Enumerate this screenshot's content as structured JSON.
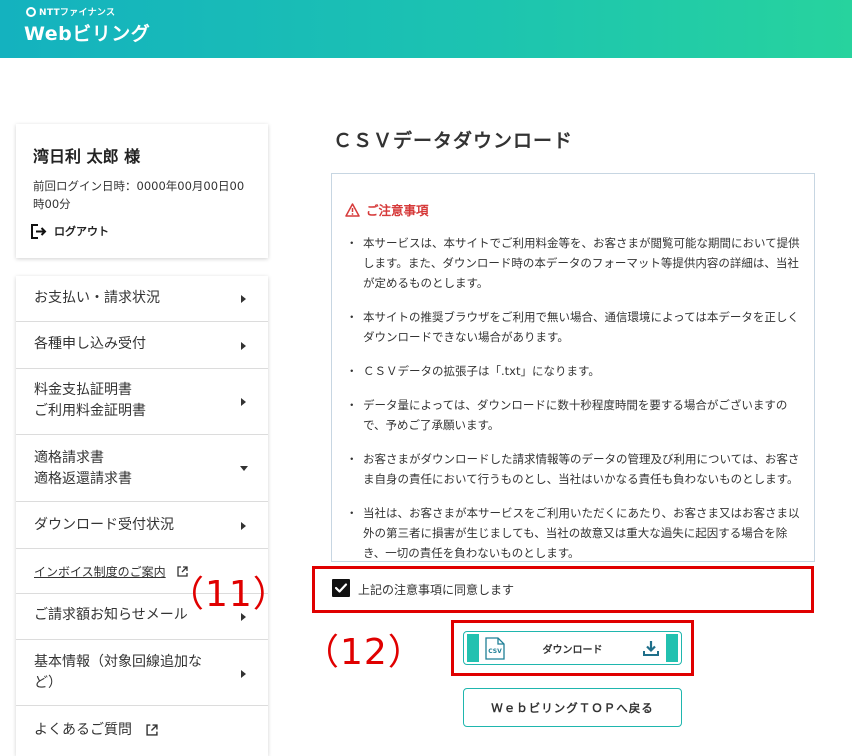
{
  "header": {
    "brand_small": "NTTファイナンス",
    "app_name": "Webビリング"
  },
  "user": {
    "name": "湾日利 太郎 様",
    "last_login": "前回ログイン日時：0000年00月00日00時00分",
    "logout_label": "ログアウト"
  },
  "nav": {
    "items": [
      {
        "label": "お支払い・請求状況"
      },
      {
        "label": "各種申し込み受付"
      },
      {
        "label_line1": "料金支払証明書",
        "label_line2": "ご利用料金証明書"
      },
      {
        "label_line1": "適格請求書",
        "label_line2": "適格返還請求書"
      },
      {
        "label": "ダウンロード受付状況"
      },
      {
        "label": "インボイス制度のご案内"
      },
      {
        "label": "ご請求額お知らせメール"
      },
      {
        "label_line1": "基本情報（対象回線追加な",
        "label_line2": "ど）"
      },
      {
        "label": "よくあるご質問"
      }
    ]
  },
  "main": {
    "title": "ＣＳＶデータダウンロード",
    "notice_title": "ご注意事項",
    "notice_bullet": "・",
    "notice_items": [
      "本サービスは、本サイトでご利用料金等を、お客さまが閲覧可能な期間において提供します。また、ダウンロード時の本データのフォーマット等提供内容の詳細は、当社が定めるものとします。",
      "本サイトの推奨ブラウザをご利用で無い場合、通信環境によっては本データを正しくダウンロードできない場合があります。",
      "ＣＳＶデータの拡張子は「.txt」になります。",
      "データ量によっては、ダウンロードに数十秒程度時間を要する場合がございますので、予めご了承願います。",
      "お客さまがダウンロードした請求情報等のデータの管理及び利用については、お客さま自身の責任において行うものとし、当社はいかなる責任も負わないものとします。",
      "当社は、お客さまが本サービスをご利用いただくにあたり、お客さま又はお客さま以外の第三者に損害が生じましても、当社の故意又は重大な過失に起因する場合を除き、一切の責任を負わないものとします。"
    ],
    "agree_label": "上記の注意事項に同意します",
    "agree_checked": true,
    "download_label": "ダウンロード",
    "csv_icon_text": "CSV",
    "back_label": "ＷｅｂビリングＴＯＰへ戻る"
  },
  "annotations": {
    "marker_11": "（11）",
    "marker_12": "（12）",
    "color": "#e00000"
  },
  "colors": {
    "header_gradient_start": "#14b2bf",
    "header_gradient_end": "#27d39e",
    "accent": "#22c1b0",
    "warning": "#d63a3a"
  }
}
